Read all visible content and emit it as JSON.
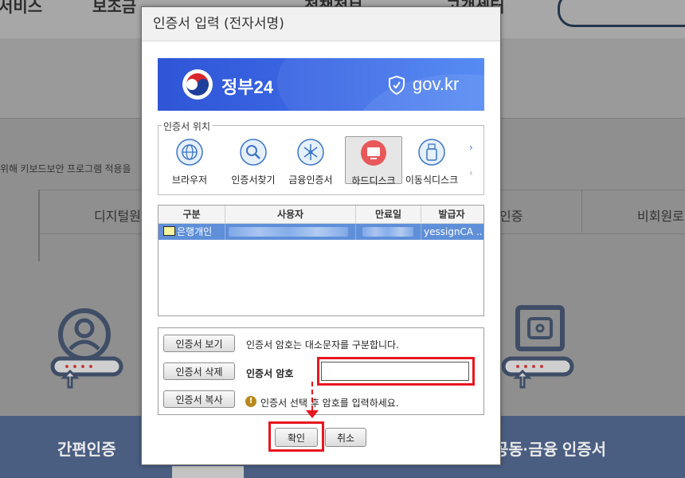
{
  "background": {
    "nav_items": [
      "서비스",
      "보조금",
      "정책정보",
      "고객센터"
    ],
    "notice": "위해 키보드보안 프로그램 적용을",
    "tabs": [
      "디지털원",
      "인증",
      "비회원로"
    ],
    "bottom_left": "간편인증",
    "bottom_right": "공동·금융 인증서"
  },
  "dialog": {
    "title": "인증서 입력 (전자서명)",
    "banner": {
      "brand": "정부24",
      "domain": "gov.kr"
    },
    "location": {
      "legend": "인증서 위치",
      "items": [
        {
          "label": "브라우저",
          "icon": "globe-icon"
        },
        {
          "label": "인증서찾기",
          "icon": "magnifier-icon"
        },
        {
          "label": "금융인증서",
          "icon": "network-icon"
        },
        {
          "label": "하드디스크",
          "icon": "monitor-icon",
          "selected": true
        },
        {
          "label": "이동식디스크",
          "icon": "usb-icon"
        }
      ],
      "next_arrow": "›",
      "prev_arrow": "‹"
    },
    "table": {
      "headers": [
        "구분",
        "사용자",
        "만료일",
        "발급자"
      ],
      "rows": [
        {
          "type": "은행개인",
          "user": "",
          "expiry": "",
          "issuer": "yessignCA ..."
        }
      ]
    },
    "actions": {
      "view_button": "인증서 보기",
      "delete_button": "인증서 삭제",
      "copy_button": "인증서 복사",
      "case_note": "인증서 암호는 대소문자를 구분합니다.",
      "password_label": "인증서 암호",
      "password_value": "",
      "hint": "인증서 선택 후 암호를 입력하세요."
    },
    "confirm_button": "확인",
    "cancel_button": "취소"
  },
  "colors": {
    "highlight": "#e8171f",
    "selection": "#5f8fd8",
    "banner": "#3c6ae6"
  }
}
